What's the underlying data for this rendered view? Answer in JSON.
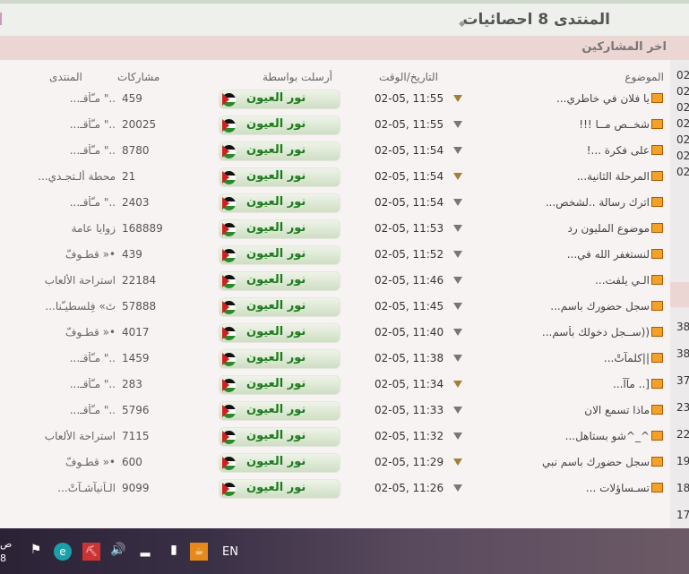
{
  "stats_title": "المنتدى 8 احصائيات",
  "section_title": "اخر المشاركين",
  "columns": {
    "topic": "الموضوع",
    "date": "التاريخ/الوقت",
    "sender": "أرسلت بواسطة",
    "posts": "مشاركات",
    "forum": "المنتدى"
  },
  "user_name": "نور العيون",
  "rows": [
    {
      "topic": "يا فلان في خاطري...",
      "date": "02-05, 11:55",
      "posts": "459",
      "forum": "..\" مـّأقـ...",
      "arrow": "gold"
    },
    {
      "topic": "شخــص مــا !!!",
      "date": "02-05, 11:55",
      "posts": "20025",
      "forum": "..\" مـّأقـ...",
      "arrow": "gray"
    },
    {
      "topic": "على فكرة ...!",
      "date": "02-05, 11:54",
      "posts": "8780",
      "forum": "..\" مـّأقـ...",
      "arrow": "gray"
    },
    {
      "topic": "المرحلة الثانية...",
      "date": "02-05, 11:54",
      "posts": "21",
      "forum": "محطة ألـتجـدي...",
      "arrow": "gold"
    },
    {
      "topic": "اترك رسالة ..لشخص...",
      "date": "02-05, 11:54",
      "posts": "2403",
      "forum": "..\" مـّأقـ...",
      "arrow": "gray"
    },
    {
      "topic": "موضوع المليون رد",
      "date": "02-05, 11:53",
      "posts": "168889",
      "forum": "زوايا عامة",
      "arrow": "gray"
    },
    {
      "topic": "لنستغفر الله في...",
      "date": "02-05, 11:52",
      "posts": "439",
      "forum": "•« قطـوفّ",
      "arrow": "gray"
    },
    {
      "topic": "الـي يلفت...",
      "date": "02-05, 11:46",
      "posts": "22184",
      "forum": "استراحة الألعاب",
      "arrow": "gray"
    },
    {
      "topic": "سجل حضورك باسم...",
      "date": "02-05, 11:45",
      "posts": "57888",
      "forum": "ٿ» فِلسطيـّنا...",
      "arrow": "gray"
    },
    {
      "topic": "((ســجل دخولك بأسم...",
      "date": "02-05, 11:40",
      "posts": "4017",
      "forum": "•« قطـوفّ",
      "arrow": "gray"
    },
    {
      "topic": "||كلمآتْ...",
      "date": "02-05, 11:38",
      "posts": "1459",
      "forum": "..\" مـّأقـ...",
      "arrow": "gray"
    },
    {
      "topic": "[.. مآآ...",
      "date": "02-05, 11:34",
      "posts": "283",
      "forum": "..\" مـّأقـ...",
      "arrow": "gold"
    },
    {
      "topic": "ماذا تسمع الان",
      "date": "02-05, 11:33",
      "posts": "5796",
      "forum": "..\" مـّأقـ...",
      "arrow": "gray"
    },
    {
      "topic": "^_^شو بستاهل...",
      "date": "02-05, 11:32",
      "posts": "7115",
      "forum": "استراحة الألعاب",
      "arrow": "gray"
    },
    {
      "topic": "سجل حضورك باسم نبي",
      "date": "02-05, 11:29",
      "posts": "600",
      "forum": "•« قطـوفّ",
      "arrow": "gold"
    },
    {
      "topic": "تسـساؤلات ...",
      "date": "02-05, 11:26",
      "posts": "9099",
      "forum": "الـاَنيآشـآتْ...",
      "arrow": "gray"
    }
  ],
  "right_top_values": [
    "02",
    "02",
    "02",
    "02",
    "02",
    "02",
    "02"
  ],
  "right_bottom_values": [
    "38",
    "38",
    "37",
    "23",
    "22",
    "19",
    "18",
    "17"
  ],
  "taskbar": {
    "language": "EN",
    "clock_line1": "ص",
    "clock_line2": "8"
  }
}
